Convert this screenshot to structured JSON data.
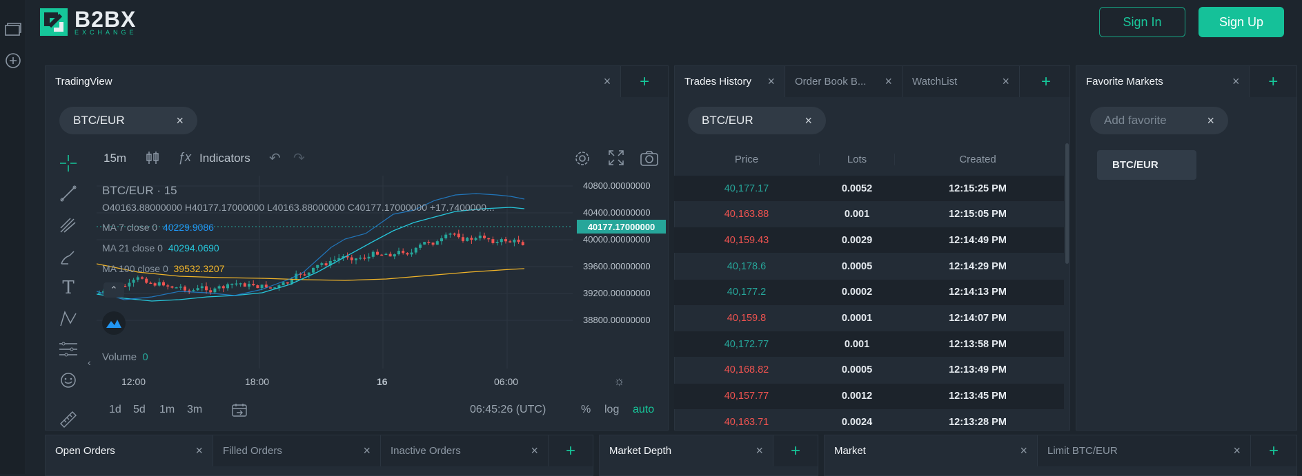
{
  "brand": {
    "name": "B2BX",
    "sub": "EXCHANGE"
  },
  "auth": {
    "signin": "Sign In",
    "signup": "Sign Up"
  },
  "tradingview": {
    "tab": "TradingView",
    "symbol_pill": "BTC/EUR",
    "interval": "15m",
    "indicators": "Indicators",
    "title": "BTC/EUR · 15",
    "ohlc": "O40163.88000000  H40177.17000000  L40163.88000000  C40177.17000000  +17.7400000...",
    "ma7_label": "MA 7 close 0",
    "ma7_value": "40229.9086",
    "ma21_label": "MA 21 close 0",
    "ma21_value": "40294.0690",
    "ma100_label": "MA 100 close 0",
    "ma100_value": "39532.3207",
    "volume_label": "Volume",
    "volume_value": "0",
    "price_tag": "40177.17000000",
    "y_ticks": [
      "40800.00000000",
      "40400.00000000",
      "40000.00000000",
      "39600.00000000",
      "39200.00000000",
      "38800.00000000"
    ],
    "x_ticks": [
      "12:00",
      "18:00",
      "16",
      "06:00"
    ],
    "ranges": [
      "1d",
      "5d",
      "1m",
      "3m"
    ],
    "clock": "06:45:26 (UTC)",
    "scale_pct": "%",
    "scale_log": "log",
    "scale_auto": "auto",
    "colors": {
      "up": "#26a69a",
      "down": "#ef5350",
      "ma7": "#2196f3",
      "ma21": "#26c6da",
      "ma100": "#f0b429",
      "accent": "#16c79a"
    }
  },
  "trades": {
    "tabs": [
      "Trades History",
      "Order Book B...",
      "WatchList"
    ],
    "symbol_pill": "BTC/EUR",
    "headers": [
      "Price",
      "Lots",
      "Created"
    ],
    "rows": [
      {
        "price": "40,177.17",
        "lots": "0.0052",
        "created": "12:15:25 PM",
        "side": "buy"
      },
      {
        "price": "40,163.88",
        "lots": "0.001",
        "created": "12:15:05 PM",
        "side": "sell"
      },
      {
        "price": "40,159.43",
        "lots": "0.0029",
        "created": "12:14:49 PM",
        "side": "sell"
      },
      {
        "price": "40,178.6",
        "lots": "0.0005",
        "created": "12:14:29 PM",
        "side": "buy"
      },
      {
        "price": "40,177.2",
        "lots": "0.0002",
        "created": "12:14:13 PM",
        "side": "buy"
      },
      {
        "price": "40,159.8",
        "lots": "0.0001",
        "created": "12:14:07 PM",
        "side": "sell"
      },
      {
        "price": "40,172.77",
        "lots": "0.001",
        "created": "12:13:58 PM",
        "side": "buy"
      },
      {
        "price": "40,168.82",
        "lots": "0.0005",
        "created": "12:13:49 PM",
        "side": "sell"
      },
      {
        "price": "40,157.77",
        "lots": "0.0012",
        "created": "12:13:45 PM",
        "side": "sell"
      },
      {
        "price": "40,163.71",
        "lots": "0.0024",
        "created": "12:13:28 PM",
        "side": "sell"
      }
    ]
  },
  "favorites": {
    "tab": "Favorite Markets",
    "placeholder": "Add favorite",
    "items": [
      "BTC/EUR"
    ]
  },
  "bottom": {
    "orders_tabs": [
      "Open Orders",
      "Filled Orders",
      "Inactive Orders"
    ],
    "depth_tab": "Market Depth",
    "market_tabs": [
      "Market",
      "Limit BTC/EUR"
    ]
  }
}
